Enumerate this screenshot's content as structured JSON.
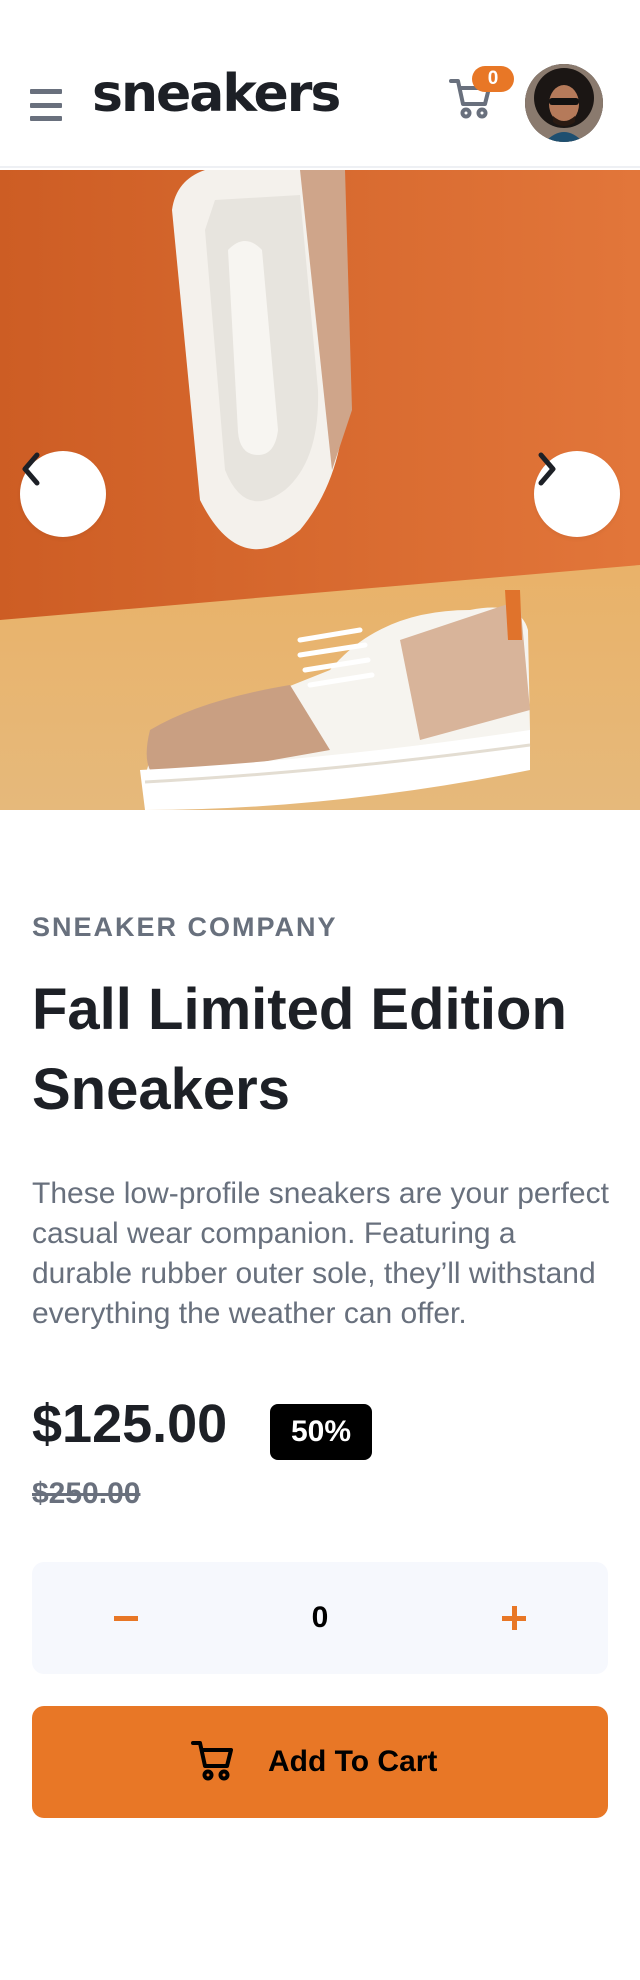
{
  "header": {
    "logo": "sneakers",
    "cart_count": "0"
  },
  "product": {
    "company": "SNEAKER COMPANY",
    "title": "Fall Limited Edition Sneakers",
    "description": "These low-profile sneakers are your perfect casual wear companion. Featuring a durable rubber outer sole, they’ll withstand everything the weather can offer.",
    "price": "$125.00",
    "discount": "50%",
    "original_price": "$250.00"
  },
  "quantity": {
    "value": "0"
  },
  "actions": {
    "add_to_cart_label": "Add To Cart"
  },
  "icons": {
    "menu": "menu-icon",
    "cart": "cart-icon",
    "prev": "chevron-left-icon",
    "next": "chevron-right-icon",
    "minus": "minus-icon",
    "plus": "plus-icon"
  },
  "colors": {
    "accent": "#e87726",
    "text_dark": "#1d2026",
    "text_muted": "#68707d",
    "stepper_bg": "#f6f8fd"
  }
}
